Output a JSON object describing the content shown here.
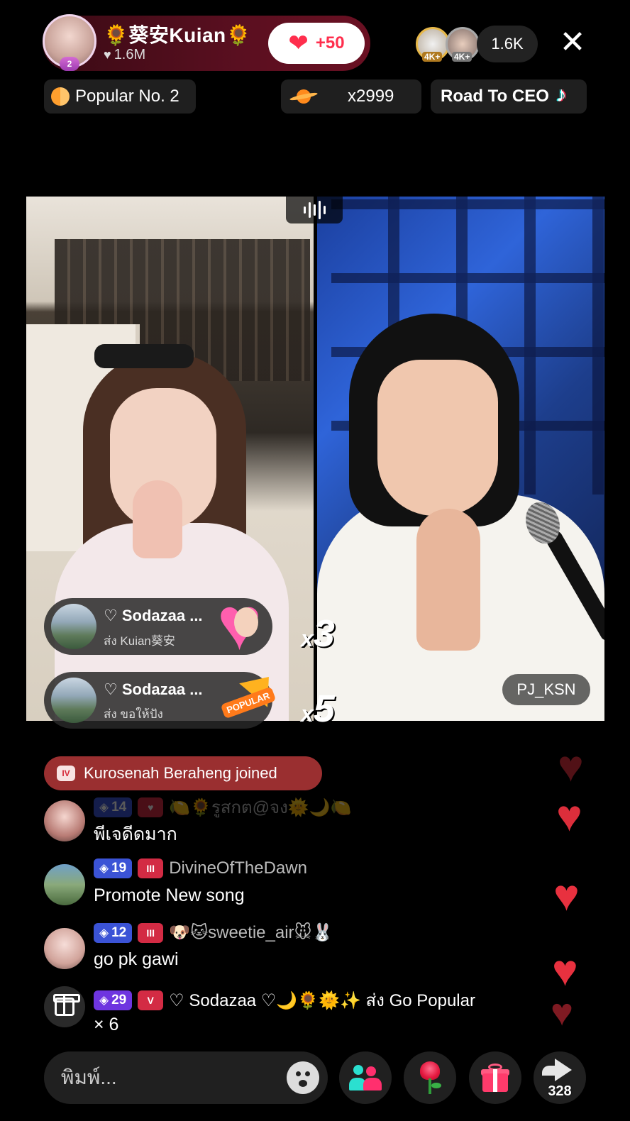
{
  "host": {
    "name": "🌻葵安Kuian🌻",
    "likes": "1.6M",
    "avatar_badge": "2",
    "like_button": {
      "heart": "❤",
      "plus": "+50"
    }
  },
  "viewers": {
    "badge_1": "4K+",
    "badge_2": "4K+",
    "count": "1.6K"
  },
  "close_label": "✕",
  "chips": {
    "popular": "Popular No. 2",
    "gift_multiplier": "x2999",
    "road_to_ceo": "Road To CEO"
  },
  "guest": {
    "name": "PJ_KSN"
  },
  "gift_notifications": [
    {
      "sender": "♡ Sodazaa ...",
      "subtitle": "ส่ง Kuian葵安",
      "multiplier_x": "x",
      "multiplier_n": "3"
    },
    {
      "sender": "♡ Sodazaa ...",
      "subtitle": "ส่ง ขอให้ปัง",
      "multiplier_x": "x",
      "multiplier_n": "5",
      "gift_label": "POPULAR"
    }
  ],
  "joined": {
    "badge": "IV",
    "text": "Kurosenah Beraheng joined"
  },
  "chat": [
    {
      "level": "14",
      "fan": "♥",
      "username": "🍋🌻รูสกต@จง🌞🌙🍋",
      "message": "พีเจดีดมาก"
    },
    {
      "level": "19",
      "fan": "III",
      "username": "DivineOfTheDawn",
      "message": "Promote New song"
    },
    {
      "level": "12",
      "fan": "III",
      "username": "🐶🐱sweetie_air🐭🐰",
      "message": "go pk gawi"
    },
    {
      "level": "29",
      "fan": "V",
      "username": "♡ Sodazaa ♡🌙🌻🌞✨ ส่ง Go Popular",
      "message": "× 6"
    }
  ],
  "comment": {
    "placeholder": "พิมพ์..."
  },
  "share_count": "328",
  "icons": {
    "close": "close-icon",
    "heart": "heart-icon",
    "gift": "gift-icon",
    "rose": "rose-icon",
    "share": "share-icon",
    "emoji": "emoji-icon",
    "collab": "collab-icon"
  },
  "colors": {
    "like_red": "#ff2e4d",
    "joined_bg": "#9a2f30",
    "level_blue": "#3b53d6",
    "level_purple": "#6e35e0",
    "fan_red": "#d32b44"
  }
}
